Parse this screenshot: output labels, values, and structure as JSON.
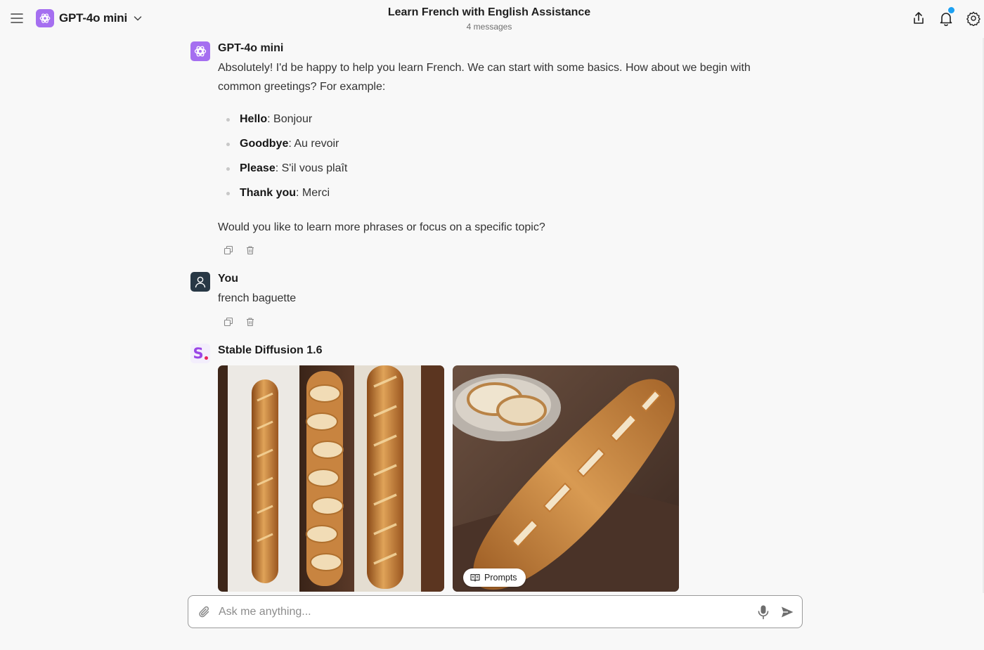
{
  "header": {
    "model_name": "GPT-4o mini",
    "title": "Learn French with English Assistance",
    "subtitle": "4 messages"
  },
  "messages": [
    {
      "author": "GPT-4o mini",
      "intro": "Absolutely! I'd be happy to help you learn French. We can start with some basics. How about we begin with common greetings? For example:",
      "items": [
        {
          "term": "Hello",
          "translation": ": Bonjour"
        },
        {
          "term": "Goodbye",
          "translation": ": Au revoir"
        },
        {
          "term": "Please",
          "translation": ": S'il vous plaît"
        },
        {
          "term": "Thank you",
          "translation": ": Merci"
        }
      ],
      "outro": "Would you like to learn more phrases or focus on a specific topic?"
    },
    {
      "author": "You",
      "text": "french baguette"
    },
    {
      "author": "Stable Diffusion 1.6",
      "prompts_label": "Prompts"
    }
  ],
  "composer": {
    "placeholder": "Ask me anything..."
  },
  "colors": {
    "model_accent": "#a56ff0",
    "user_avatar": "#283845",
    "notification_dot": "#1da1f2",
    "sd_logo": "#9a46e6"
  },
  "icons": [
    "menu-icon",
    "openai-logo-icon",
    "chevron-down-icon",
    "share-icon",
    "bell-icon",
    "settings-icon",
    "copy-icon",
    "trash-icon",
    "user-icon",
    "paperclip-icon",
    "microphone-icon",
    "send-icon",
    "book-icon"
  ]
}
